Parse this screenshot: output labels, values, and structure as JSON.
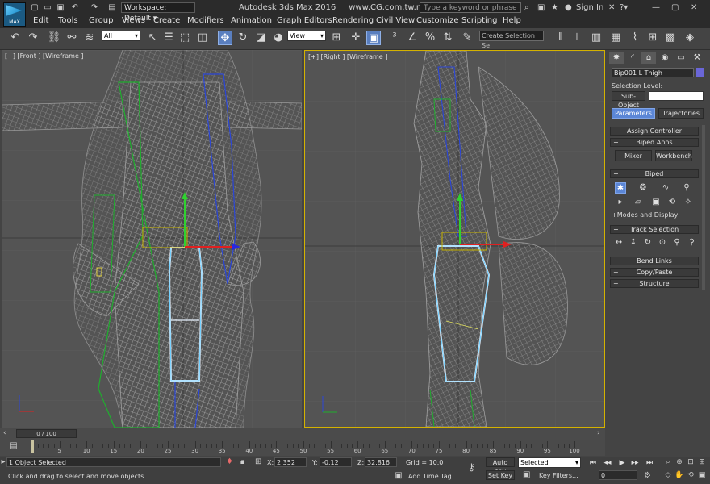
{
  "app": {
    "logo_text": "MAX",
    "title": "Autodesk 3ds Max 2016",
    "watermark": "www.CG.com.tw.max",
    "workspace_label": "Workspace: Default",
    "search_placeholder": "Type a keyword or phrase",
    "sign_in": "Sign In"
  },
  "menu": [
    "Edit",
    "Tools",
    "Group",
    "Views",
    "Create",
    "Modifiers",
    "Animation",
    "Graph Editors",
    "Rendering",
    "Civil View",
    "Customize",
    "Scripting",
    "Help"
  ],
  "toolbar": {
    "filter_value": "All",
    "refcoord_value": "View",
    "selection_set_placeholder": "Create Selection Se"
  },
  "viewports": {
    "front_label": "[+] [Front ] [Wireframe ]",
    "right_label": "[+] [Right ] [Wireframe ]"
  },
  "command_panel": {
    "object_name": "Bip001 L Thigh",
    "object_color": "#6a66d8",
    "selection_level_label": "Selection Level:",
    "sub_object_label": "Sub-Object",
    "tabs": [
      "Parameters",
      "Trajectories"
    ],
    "rollouts": {
      "assign_controller": "Assign Controller",
      "biped_apps": "Biped Apps",
      "mixer": "Mixer",
      "workbench": "Workbench",
      "biped": "Biped",
      "modes_display": "Modes and Display",
      "track_selection": "Track Selection",
      "bend_links": "Bend Links",
      "copy_paste": "Copy/Paste",
      "structure": "Structure"
    }
  },
  "timeline": {
    "frame_display": "0 / 100",
    "ticks": [
      "0",
      "5",
      "10",
      "15",
      "20",
      "25",
      "30",
      "35",
      "40",
      "45",
      "50",
      "55",
      "60",
      "65",
      "70",
      "75",
      "80",
      "85",
      "90",
      "95",
      "100"
    ]
  },
  "status": {
    "selected_count": "1 Object Selected",
    "prompt": "Click and drag to select and move objects",
    "x_label": "X:",
    "x_value": "2.352",
    "y_label": "Y:",
    "y_value": "-0.12",
    "z_label": "Z:",
    "z_value": "32.816",
    "grid": "Grid = 10.0",
    "add_time_tag": "Add Time Tag",
    "auto_key": "Auto Key",
    "set_key": "Set Key",
    "key_mode_value": "Selected",
    "key_filters": "Key Filters...",
    "current_frame": "0"
  }
}
